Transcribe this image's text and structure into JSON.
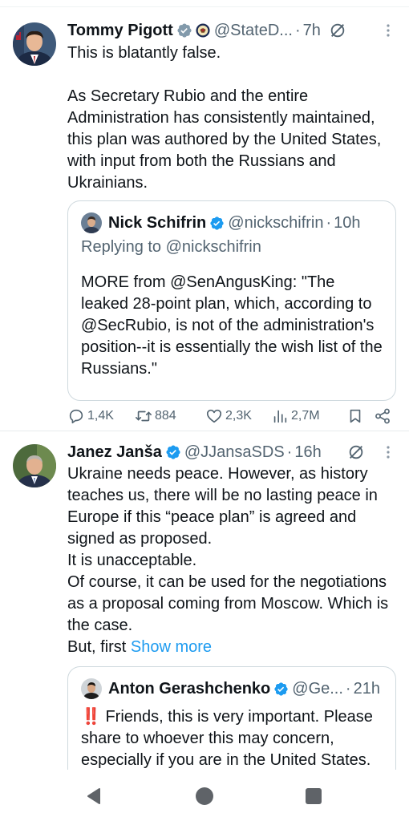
{
  "tweets": [
    {
      "author_name": "Tommy Pigott",
      "handle": "@StateD...",
      "separator": "·",
      "time": "7h",
      "text": "This is blatantly false.\n\nAs Secretary Rubio and the entire Administration has consistently maintained, this plan was authored by the United States, with input from both the Russians and Ukrainians.",
      "quote": {
        "author_name": "Nick Schifrin",
        "handle": "@nickschifrin",
        "separator": "·",
        "time": "10h",
        "replying_to": "Replying to @nickschifrin",
        "text": "MORE from @SenAngusKing: \"The leaked 28-point plan, which, according to @SecRubio, is not of the administration's position--it is essentially the wish list of the Russians.\""
      },
      "stats": {
        "replies": "1,4K",
        "reposts": "884",
        "likes": "2,3K",
        "views": "2,7M"
      }
    },
    {
      "author_name": "Janez Janša",
      "handle": "@JJansaSDS",
      "separator": "·",
      "time": "16h",
      "text": "Ukraine needs peace. However, as history teaches us, there will be no lasting peace in Europe if this “peace plan” is agreed and signed as proposed.\nIt is unacceptable.\nOf course, it can be used for the negotiations as a proposal coming from Moscow. Which is the case.\nBut, first ",
      "show_more": "Show more",
      "quote": {
        "author_name": "Anton Gerashchenko",
        "handle": "@Ge...",
        "separator": "·",
        "time": "21h",
        "text": "‼️ Friends, this is very important. Please share to whoever this may concern, especially if you are in the United States."
      }
    }
  ],
  "icons": {
    "verified": "verified-badge-icon",
    "government": "state-department-seal-icon",
    "grok": "grok-icon",
    "more": "more-options-icon",
    "reply": "reply-icon",
    "repost": "repost-icon",
    "like": "heart-icon",
    "views": "views-icon",
    "bookmark": "bookmark-icon",
    "share": "share-icon"
  },
  "colors": {
    "accent": "#1d9bf0",
    "text": "#0f1419",
    "secondary": "#536471",
    "border": "#cfd9de"
  },
  "navbar": [
    "back-button",
    "home-button",
    "recent-apps-button"
  ]
}
